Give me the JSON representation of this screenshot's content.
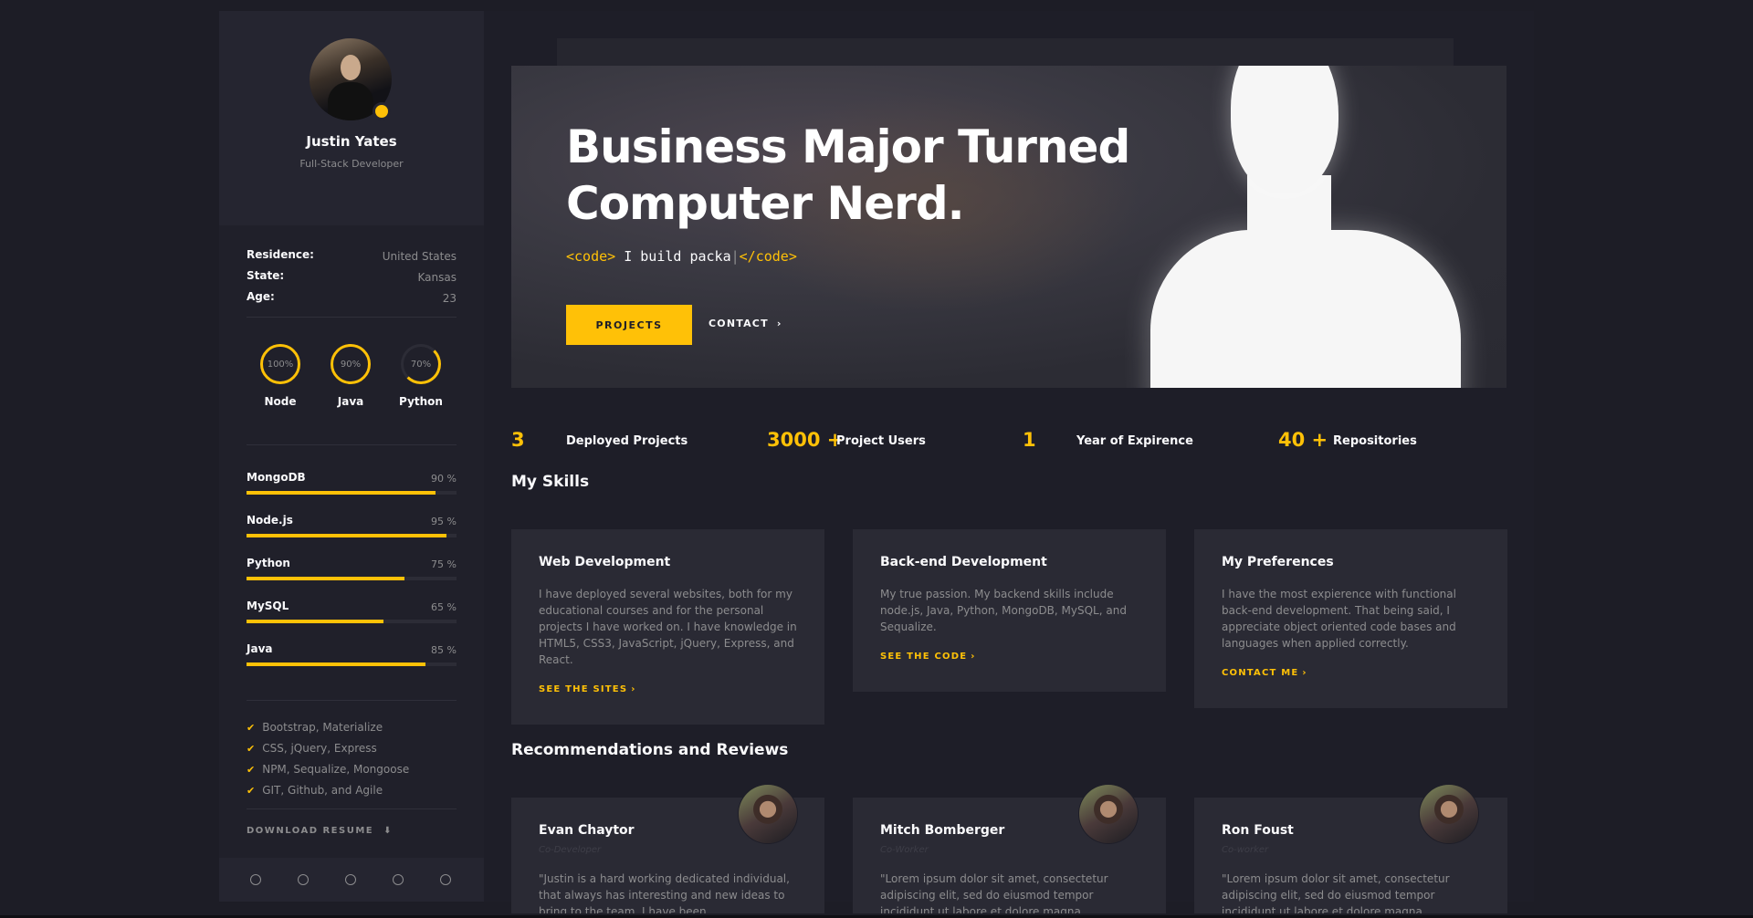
{
  "profile": {
    "name": "Justin Yates",
    "role": "Full-Stack Developer"
  },
  "info": [
    {
      "key": "Residence:",
      "value": "United States"
    },
    {
      "key": "State:",
      "value": "Kansas"
    },
    {
      "key": "Age:",
      "value": "23"
    }
  ],
  "circles": [
    {
      "pct": "100%",
      "label": "Node"
    },
    {
      "pct": "90%",
      "label": "Java"
    },
    {
      "pct": "70%",
      "label": "Python"
    }
  ],
  "bars": [
    {
      "label": "MongoDB",
      "pct_text": "90 %",
      "value": 90
    },
    {
      "label": "Node.js",
      "pct_text": "95 %",
      "value": 95
    },
    {
      "label": "Python",
      "pct_text": "75 %",
      "value": 75
    },
    {
      "label": "MySQL",
      "pct_text": "65 %",
      "value": 65
    },
    {
      "label": "Java",
      "pct_text": "85 %",
      "value": 85
    }
  ],
  "checks": [
    "Bootstrap, Materialize",
    "CSS, jQuery, Express",
    "NPM, Sequalize, Mongoose",
    "GIT, Github, and Agile"
  ],
  "download_label": "DOWNLOAD RESUME",
  "hero": {
    "title": "Business Major Turned Computer Nerd.",
    "code_open": "<code>",
    "code_text": " I build packa",
    "code_close": "</code>",
    "projects_label": "PROJECTS",
    "contact_label": "CONTACT"
  },
  "stats": [
    {
      "num": "3",
      "label": "Deployed Projects"
    },
    {
      "num": "3000 +",
      "label": "Project Users"
    },
    {
      "num": "1",
      "label": "Year of Expirence"
    },
    {
      "num": "40 +",
      "label": "Repositories"
    }
  ],
  "skills_title": "My Skills",
  "skills": [
    {
      "title": "Web Development",
      "desc": "I have deployed several websites, both for my educational courses and for the personal projects I have worked on. I have knowledge in HTML5, CSS3, JavaScript, jQuery, Express, and React.",
      "link": "SEE THE SITES"
    },
    {
      "title": "Back-end Development",
      "desc": "My true passion. My backend skills include node.js, Java, Python, MongoDB, MySQL, and Sequalize.",
      "link": "SEE THE CODE"
    },
    {
      "title": "My Preferences",
      "desc": "I have the most expierence with functional back-end development. That being said, I appreciate object oriented code bases and languages when applied correctly.",
      "link": "CONTACT ME"
    }
  ],
  "reviews_title": "Recommendations and Reviews",
  "reviews": [
    {
      "name": "Evan Chaytor",
      "role": "Co-Developer",
      "quote": "\"Justin is a hard working dedicated individual, that always has interesting and new ideas to bring to the team. I have been"
    },
    {
      "name": "Mitch Bomberger",
      "role": "Co-Worker",
      "quote": "\"Lorem ipsum dolor sit amet, consectetur adipiscing elit, sed do eiusmod tempor incididunt ut labore et dolore magna"
    },
    {
      "name": "Ron Foust",
      "role": "Co-worker",
      "quote": "\"Lorem ipsum dolor sit amet, consectetur adipiscing elit, sed do eiusmod tempor incididunt ut labore et dolore magna"
    }
  ],
  "colors": {
    "accent": "#ffc107",
    "background": "#1e1e28",
    "card": "#2a2a34"
  },
  "icons": {
    "check": "check-icon",
    "download": "download-icon",
    "chevron": "chevron-right-icon"
  }
}
